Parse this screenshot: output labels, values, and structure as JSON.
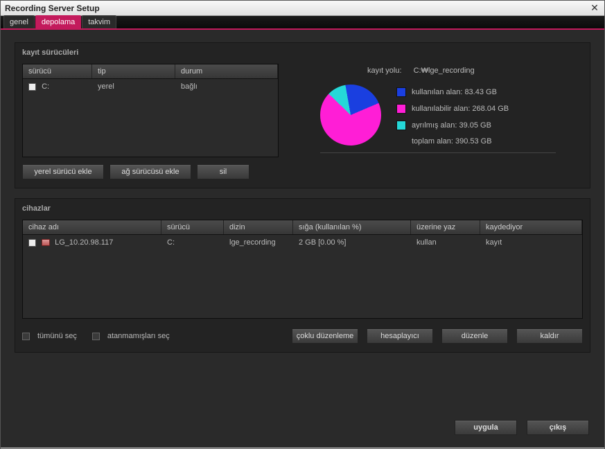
{
  "window": {
    "title": "Recording Server Setup"
  },
  "tabs": {
    "general": "genel",
    "storage": "depolama",
    "calendar": "takvim"
  },
  "drives_panel": {
    "title": "kayıt sürücüleri",
    "headers": {
      "drive": "sürücü",
      "type": "tip",
      "status": "durum"
    },
    "row": {
      "drive": "C:",
      "type": "yerel",
      "status": "bağlı"
    },
    "buttons": {
      "add_local": "yerel sürücü ekle",
      "add_network": "ağ sürücüsü ekle",
      "delete": "sil"
    },
    "path_label": "kayıt yolu:",
    "path_value": "C:₩lge_recording",
    "legend": {
      "used": "kullanılan alan: 83.43 GB",
      "available": "kullanılabilir alan: 268.04 GB",
      "reserved": "ayrılmış alan: 39.05 GB",
      "total": "toplam alan: 390.53 GB"
    }
  },
  "devices_panel": {
    "title": "cihazlar",
    "headers": {
      "name": "cihaz adı",
      "drive": "sürücü",
      "dir": "dizin",
      "capacity": "sığa (kullanılan %)",
      "overwrite": "üzerine yaz",
      "recording": "kaydediyor"
    },
    "row": {
      "name": "LG_10.20.98.117",
      "drive": "C:",
      "dir": "lge_recording",
      "capacity": "2 GB [0.00 %]",
      "overwrite": "kullan",
      "recording": "kayıt"
    },
    "checks": {
      "select_all": "tümünü seç",
      "select_unassigned": "atanmamışları seç"
    },
    "actions": {
      "multi_edit": "çoklu düzenleme",
      "calculator": "hesaplayıcı",
      "edit": "düzenle",
      "remove": "kaldır"
    }
  },
  "footer": {
    "apply": "uygula",
    "exit": "çıkış"
  },
  "chart_data": {
    "type": "pie",
    "title": "",
    "series": [
      {
        "name": "kullanılan alan",
        "value": 83.43,
        "color": "#1a3fe0"
      },
      {
        "name": "kullanılabilir alan",
        "value": 268.04,
        "color": "#ff1ed6"
      },
      {
        "name": "ayrılmış alan",
        "value": 39.05,
        "color": "#25d8d8"
      }
    ],
    "total": 390.53,
    "unit": "GB"
  }
}
